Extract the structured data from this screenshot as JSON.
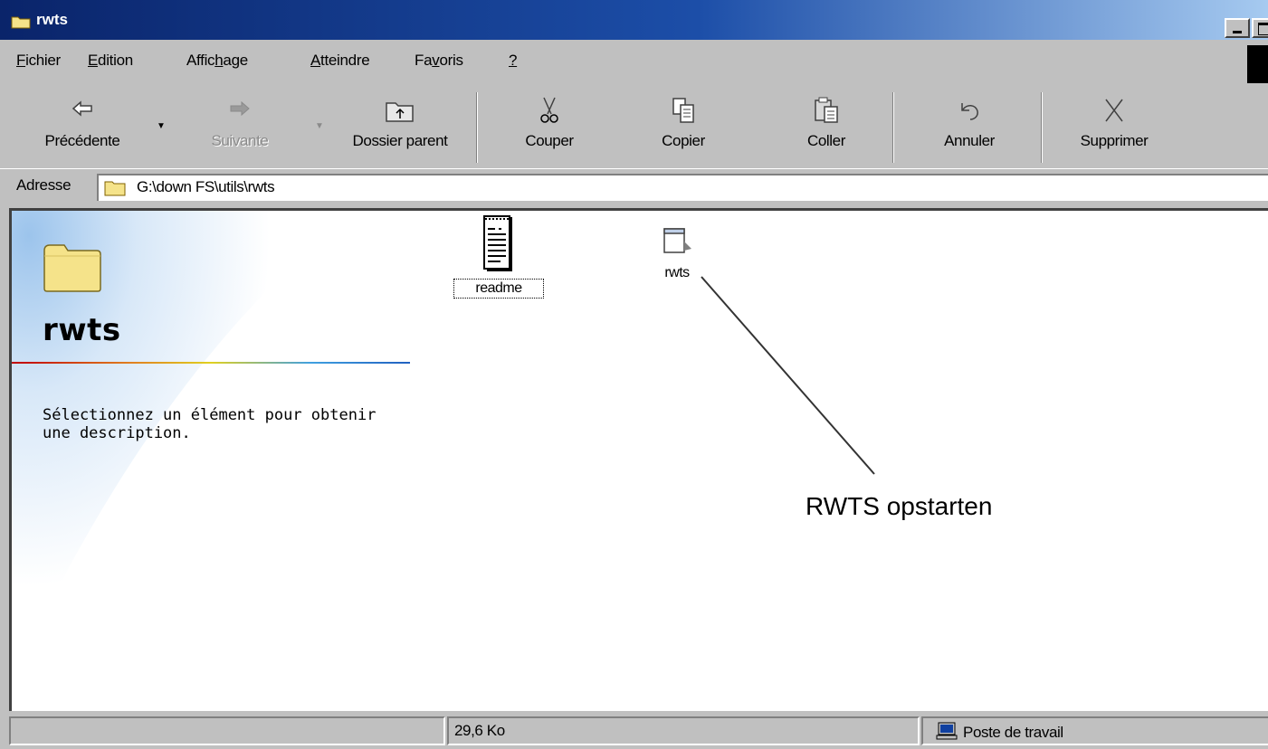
{
  "window": {
    "title": "rwts"
  },
  "menu": {
    "items": [
      {
        "pre": "",
        "key": "F",
        "post": "ichier"
      },
      {
        "pre": "",
        "key": "E",
        "post": "dition"
      },
      {
        "pre": "Affic",
        "key": "h",
        "post": "age"
      },
      {
        "pre": "",
        "key": "A",
        "post": "tteindre"
      },
      {
        "pre": "Fa",
        "key": "v",
        "post": "oris"
      },
      {
        "pre": "",
        "key": "?",
        "post": ""
      }
    ]
  },
  "toolbar": {
    "back": "Précédente",
    "forward": "Suivante",
    "up": "Dossier parent",
    "cut": "Couper",
    "copy": "Copier",
    "paste": "Coller",
    "undo": "Annuler",
    "delete": "Supprimer"
  },
  "address": {
    "label": "Adresse",
    "path": "G:\\down FS\\utils\\rwts"
  },
  "panel": {
    "folder_name": "rwts",
    "description": "Sélectionnez un élément pour obtenir une description."
  },
  "files": [
    {
      "name": "readme",
      "icon": "text-document-icon",
      "selected": true
    },
    {
      "name": "rwts",
      "icon": "application-icon",
      "selected": false
    }
  ],
  "annotation": {
    "text": "RWTS opstarten"
  },
  "status": {
    "left": "",
    "size": "29,6 Ko",
    "zone": "Poste de travail"
  },
  "colors": {
    "titlebar_start": "#0a246a",
    "titlebar_end": "#a6caf0",
    "chrome": "#c0c0c0",
    "folder_yellow": "#f5e38a"
  }
}
